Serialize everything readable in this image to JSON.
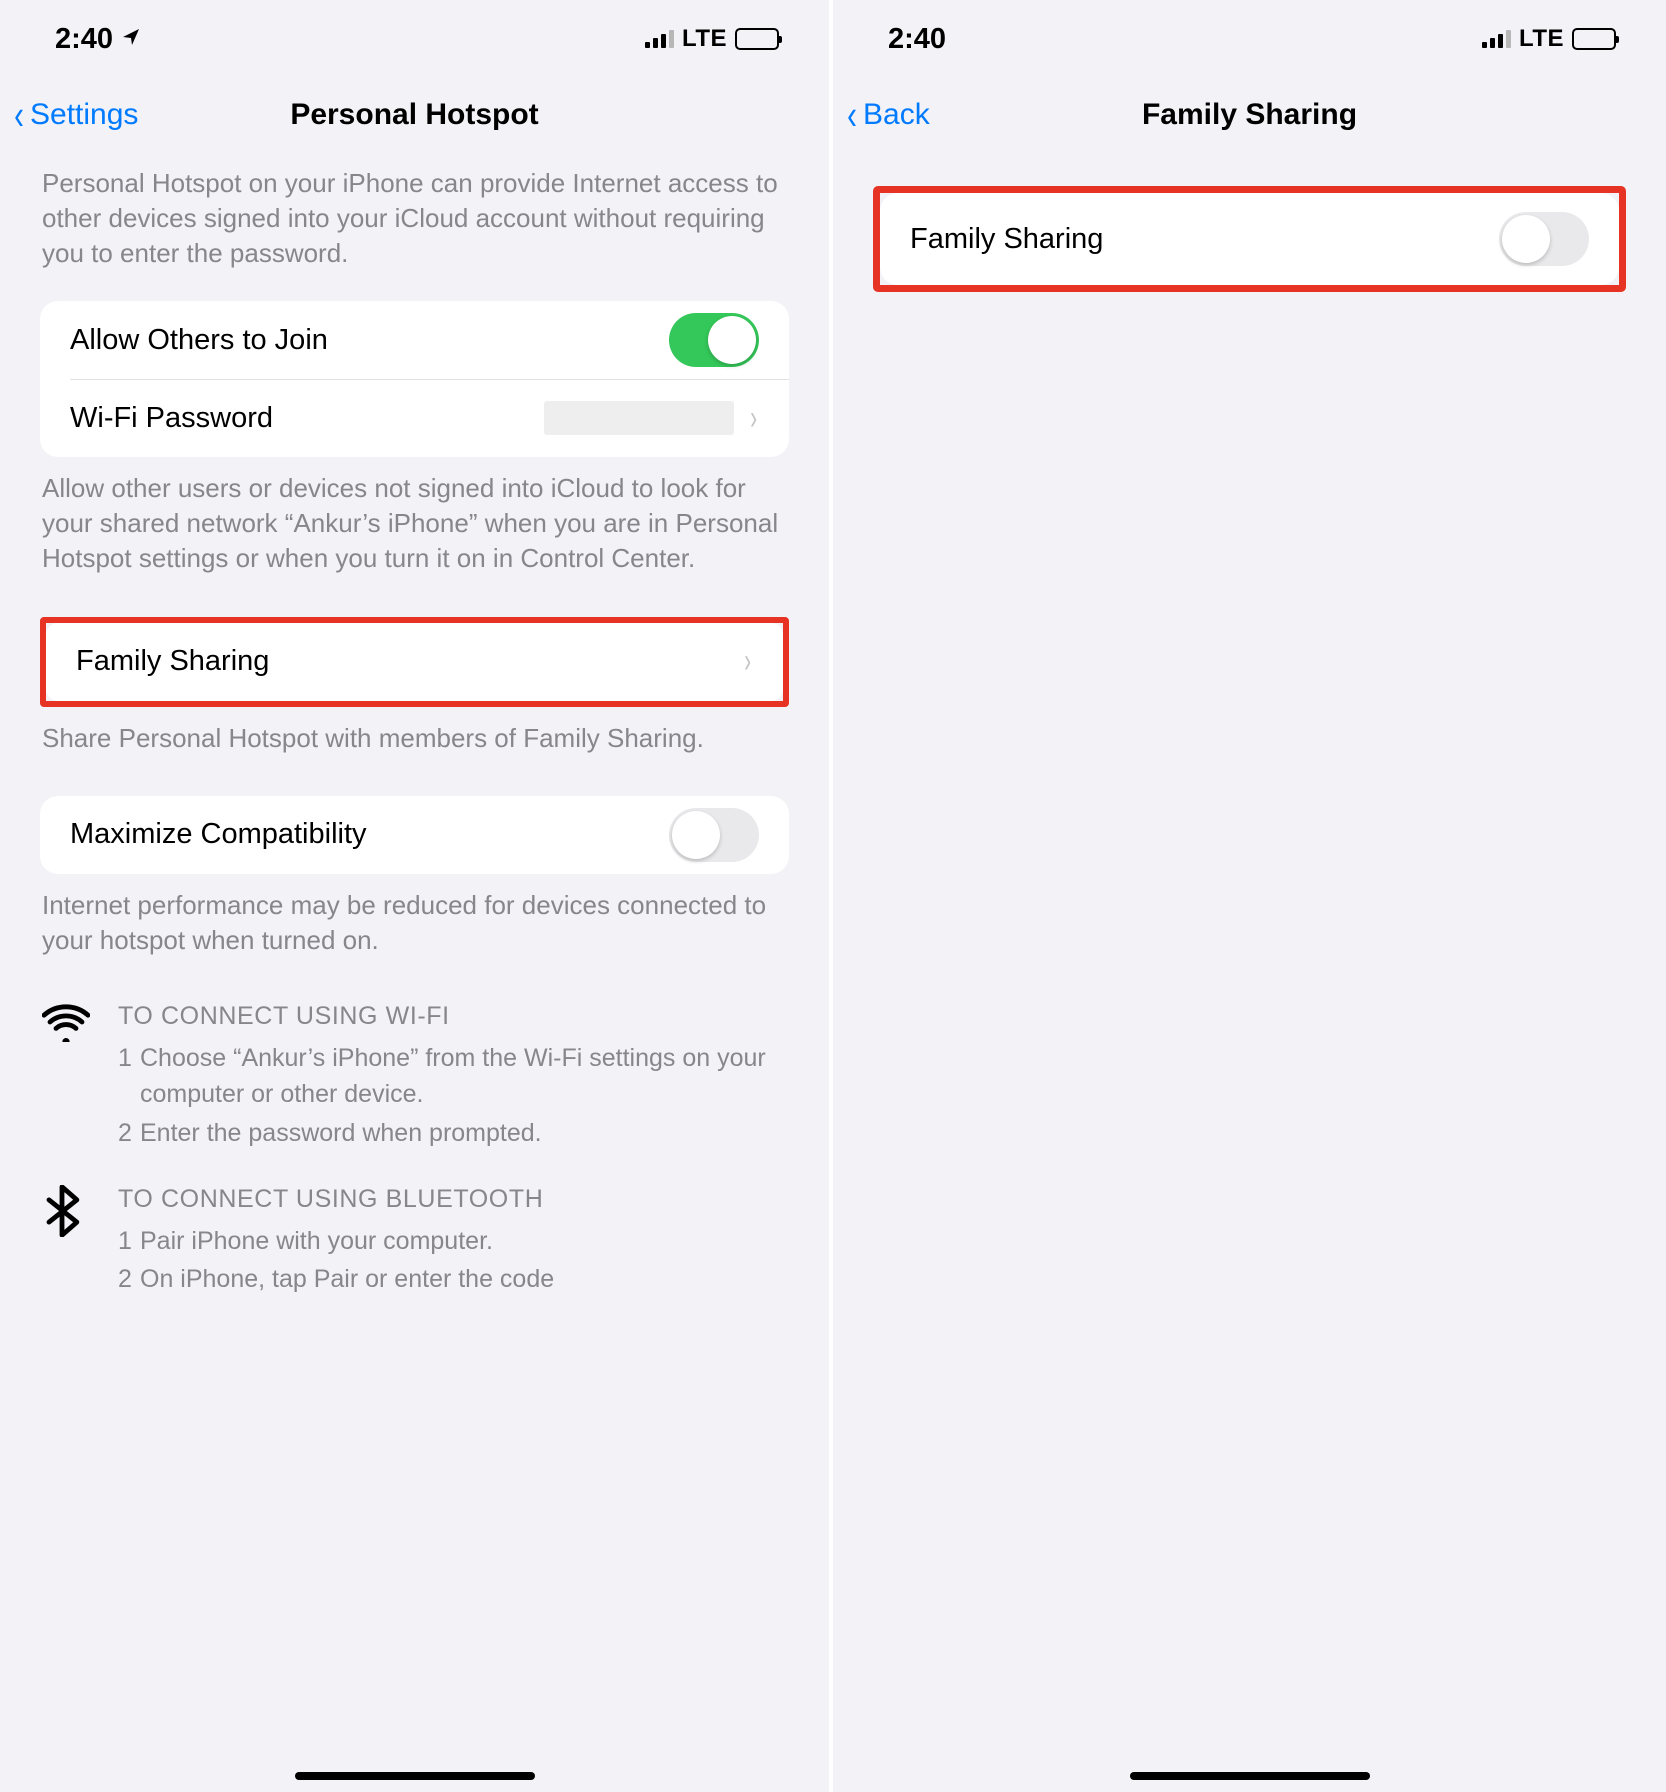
{
  "status": {
    "time": "2:40",
    "network": "LTE"
  },
  "left": {
    "back_label": "Settings",
    "title": "Personal Hotspot",
    "intro": "Personal Hotspot on your iPhone can provide Internet access to other devices signed into your iCloud account without requiring you to enter the password.",
    "allow_others_label": "Allow Others to Join",
    "wifi_password_label": "Wi-Fi Password",
    "allow_others_footer": "Allow other users or devices not signed into iCloud to look for your shared network “Ankur’s iPhone” when you are in Personal Hotspot settings or when you turn it on in Control Center.",
    "family_sharing_label": "Family Sharing",
    "family_sharing_footer": "Share Personal Hotspot with members of Family Sharing.",
    "maximize_label": "Maximize Compatibility",
    "maximize_footer": "Internet performance may be reduced for devices connected to your hotspot when turned on.",
    "wifi_heading": "TO CONNECT USING WI-FI",
    "wifi_step1": "Choose “Ankur’s iPhone” from the Wi-Fi settings on your computer or other device.",
    "wifi_step2": "Enter the password when prompted.",
    "bt_heading": "TO CONNECT USING BLUETOOTH",
    "bt_step1": "Pair iPhone with your computer.",
    "bt_step2": "On iPhone, tap Pair or enter the code"
  },
  "right": {
    "back_label": "Back",
    "title": "Family Sharing",
    "row_label": "Family Sharing"
  }
}
